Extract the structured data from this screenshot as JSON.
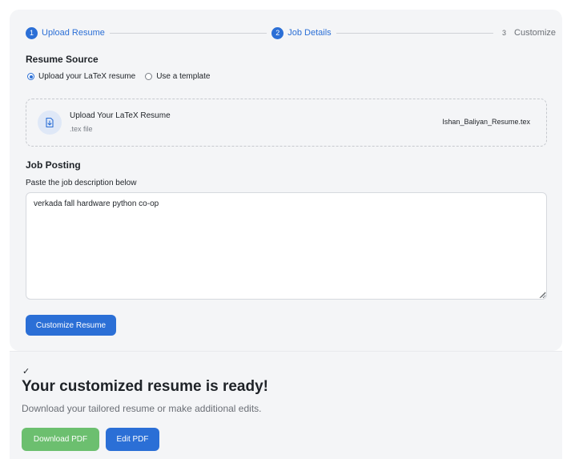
{
  "stepper": {
    "steps": [
      {
        "number": "1",
        "label": "Upload Resume",
        "active": true
      },
      {
        "number": "2",
        "label": "Job Details",
        "active": true
      },
      {
        "number": "3",
        "label": "Customize",
        "active": false
      }
    ]
  },
  "resume_source": {
    "title": "Resume Source",
    "options": [
      {
        "label": "Upload your LaTeX resume",
        "selected": true
      },
      {
        "label": "Use a template",
        "selected": false
      }
    ],
    "upload": {
      "title": "Upload Your LaTeX Resume",
      "subtitle": ".tex file",
      "filename": "Ishan_Baliyan_Resume.tex",
      "icon": "file-upload-icon"
    }
  },
  "job_posting": {
    "title": "Job Posting",
    "label": "Paste the job description below",
    "value": "verkada fall hardware python co-op"
  },
  "actions": {
    "customize_label": "Customize Resume"
  },
  "result": {
    "check": "✓",
    "title": "Your customized resume is ready!",
    "subtitle": "Download your tailored resume or make additional edits.",
    "download_label": "Download PDF",
    "edit_label": "Edit PDF"
  },
  "colors": {
    "accent": "#2b6fd6",
    "success": "#6cbf6f",
    "panel": "#f4f5f7"
  }
}
